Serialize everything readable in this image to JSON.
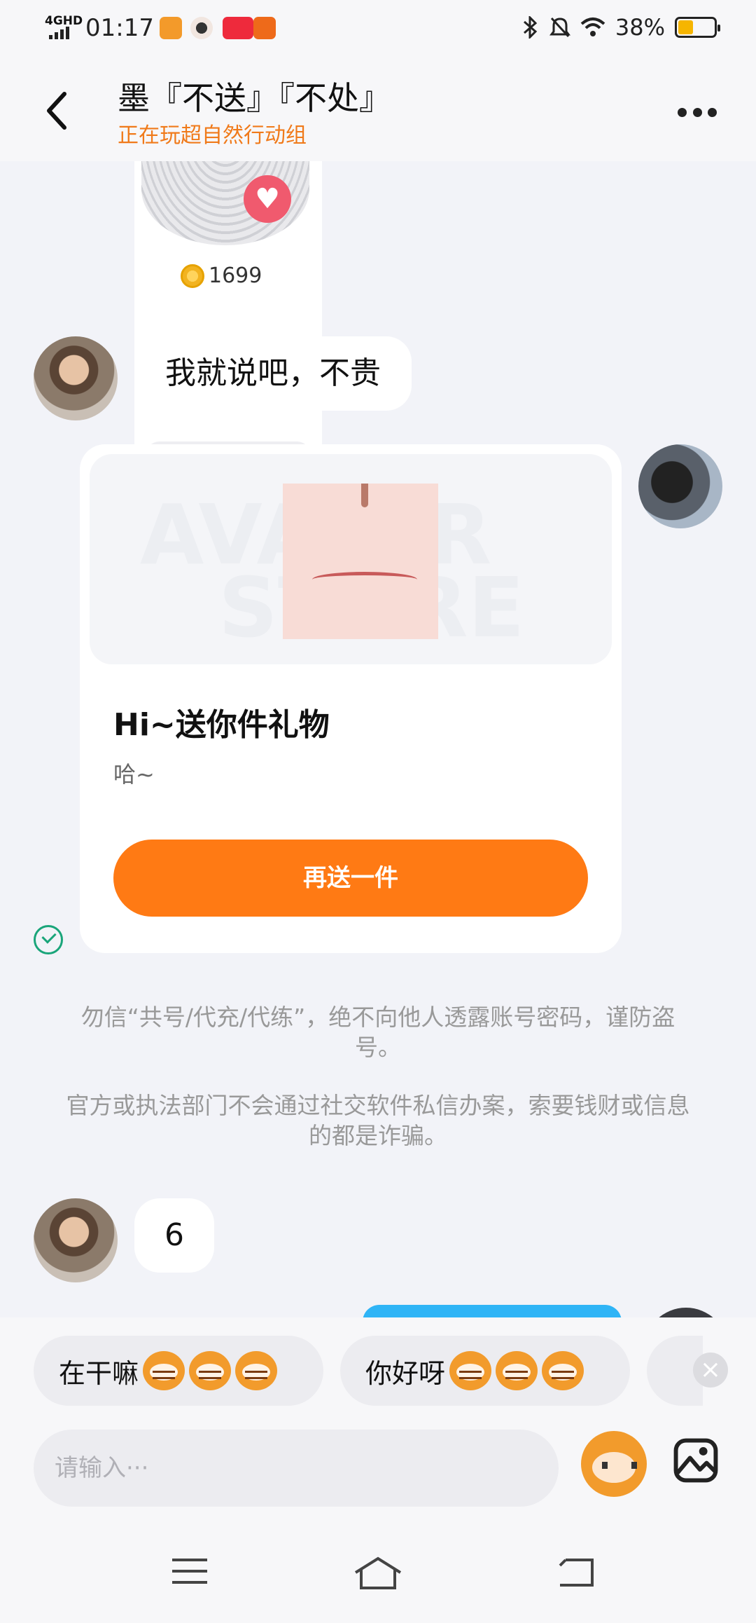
{
  "status_bar": {
    "network": "4GHD",
    "time": "01:17",
    "battery": "38%",
    "battery_level": 0.38,
    "icons": [
      "signal-icon",
      "app-icon",
      "avatar-icon",
      "app-icon",
      "app-icon",
      "bluetooth-icon",
      "mute-icon",
      "wifi-icon",
      "battery-icon"
    ]
  },
  "header": {
    "title": "墨『不送』『不处』",
    "subtitle": "正在玩超自然行动组"
  },
  "messages": {
    "gift_price": "1699",
    "msg1": "我就说吧，不贵",
    "gift_card": {
      "title": "Hi~送你件礼物",
      "desc": "哈~",
      "button": "再送一件",
      "watermark_line1": "AVATAR",
      "watermark_line2": "STORE"
    },
    "notice1": "勿信“共号/代充/代练”，绝不向他人透露账号密码，谨防盗号。",
    "notice2": "官方或执法部门不会通过社交软件私信办案，索要钱财或信息的都是诈骗。",
    "msg2": "6"
  },
  "quick_replies": [
    {
      "label": "在干嘛"
    },
    {
      "label": "你好呀"
    }
  ],
  "input": {
    "placeholder": "请输入···"
  },
  "colors": {
    "accent_orange": "#ff7a14",
    "subtitle_orange": "#f07a1a",
    "read_green": "#1aa57a",
    "bubble_blue": "#2fb4f6"
  }
}
